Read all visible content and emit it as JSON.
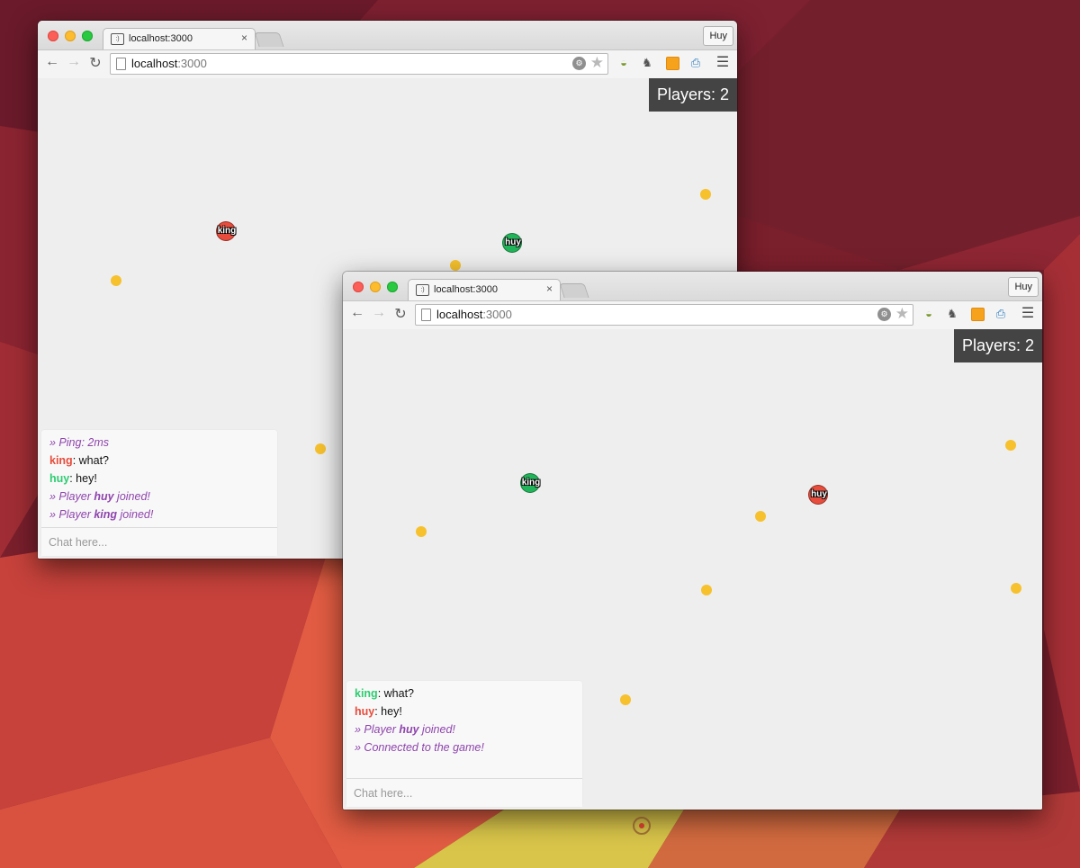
{
  "desktop": {
    "colors": {
      "base": "#7a1f2c",
      "accent": "#e0553f",
      "glow": "#f07a4a",
      "yellow": "#e9c545"
    }
  },
  "windows": [
    {
      "tab_title": "localhost:3000",
      "url_host": "localhost",
      "url_port": ":3000",
      "profile_name": "Huy",
      "players_label": "Players: 2",
      "players": [
        {
          "name": "king",
          "color": "red"
        },
        {
          "name": "huy",
          "color": "green"
        }
      ],
      "chat": {
        "messages": [
          {
            "type": "system",
            "text": "» Ping: 2ms"
          },
          {
            "type": "user",
            "user": "king",
            "user_color": "red",
            "text": ": what?"
          },
          {
            "type": "user",
            "user": "huy",
            "user_color": "green",
            "text": ": hey!"
          },
          {
            "type": "system",
            "prefix": "» Player ",
            "user": "huy",
            "suffix": " joined!"
          },
          {
            "type": "system",
            "prefix": "» Player ",
            "user": "king",
            "suffix": " joined!"
          }
        ],
        "placeholder": "Chat here..."
      }
    },
    {
      "tab_title": "localhost:3000",
      "url_host": "localhost",
      "url_port": ":3000",
      "profile_name": "Huy",
      "players_label": "Players: 2",
      "players": [
        {
          "name": "king",
          "color": "green"
        },
        {
          "name": "huy",
          "color": "red"
        }
      ],
      "chat": {
        "messages": [
          {
            "type": "user",
            "user": "king",
            "user_color": "green",
            "text": ": what?"
          },
          {
            "type": "user",
            "user": "huy",
            "user_color": "red",
            "text": ": hey!"
          },
          {
            "type": "system",
            "prefix": "» Player ",
            "user": "huy",
            "suffix": " joined!"
          },
          {
            "type": "system",
            "text": "» Connected to the game!"
          }
        ],
        "placeholder": "Chat here..."
      }
    }
  ],
  "icons": {
    "back": "back-arrow-icon",
    "forward": "forward-arrow-icon",
    "reload": "reload-icon",
    "page": "page-icon",
    "star": "bookmark-star-icon",
    "menu": "hamburger-menu-icon",
    "dock": "dock-indicator-icon"
  }
}
